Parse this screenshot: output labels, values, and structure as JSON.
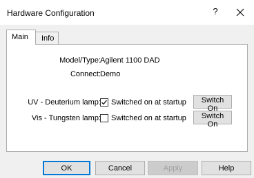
{
  "window": {
    "title": "Hardware Configuration",
    "help_glyph": "?"
  },
  "tabs": [
    {
      "label": "Main",
      "active": true
    },
    {
      "label": "Info",
      "active": false
    }
  ],
  "info": {
    "model_label": "Model/Type:",
    "model_value": "Agilent 1100 DAD",
    "connect_label": "Connect:",
    "connect_value": "Demo"
  },
  "lamps": [
    {
      "label": "UV - Deuterium lamp:",
      "checkbox_label": "Switched on at startup",
      "checked": true,
      "button": "Switch On"
    },
    {
      "label": "Vis - Tungsten lamp:",
      "checkbox_label": "Switched on at startup",
      "checked": false,
      "button": "Switch On"
    }
  ],
  "buttons": {
    "ok": "OK",
    "cancel": "Cancel",
    "apply": "Apply",
    "help": "Help"
  },
  "icons": [
    "help-icon",
    "close-icon",
    "checkmark-icon"
  ],
  "colors": {
    "accent": "#0078d7",
    "dialog_bg": "#f0f0f0",
    "panel_bg": "#ffffff"
  }
}
